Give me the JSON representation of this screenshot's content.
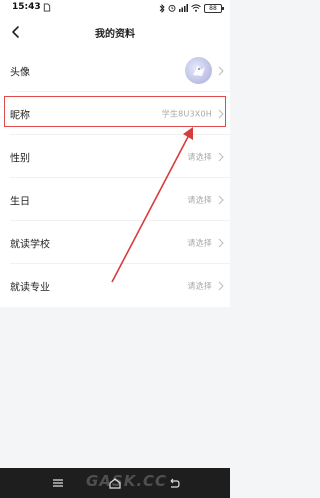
{
  "status_bar": {
    "time": "15:43",
    "battery": "88",
    "icons": [
      "sim-card-icon",
      "bluetooth-icon",
      "alarm-icon",
      "signal-icon",
      "wifi-icon",
      "battery-icon"
    ]
  },
  "header": {
    "title": "我的资料",
    "back_icon": "chevron-left-icon"
  },
  "profile_rows": [
    {
      "label": "头像",
      "value": "",
      "type": "avatar"
    },
    {
      "label": "昵称",
      "value": "学生8U3X0H"
    },
    {
      "label": "性别",
      "value": "请选择"
    },
    {
      "label": "生日",
      "value": "请选择"
    },
    {
      "label": "就读学校",
      "value": "请选择"
    },
    {
      "label": "就读专业",
      "value": "请选择"
    }
  ],
  "annotation": {
    "highlight_color": "#e04a4a",
    "arrow_color": "#d93b3b"
  },
  "nav_bar": {
    "buttons": [
      "menu-icon",
      "home-icon",
      "back-icon"
    ]
  },
  "watermark": "GASK.CC"
}
